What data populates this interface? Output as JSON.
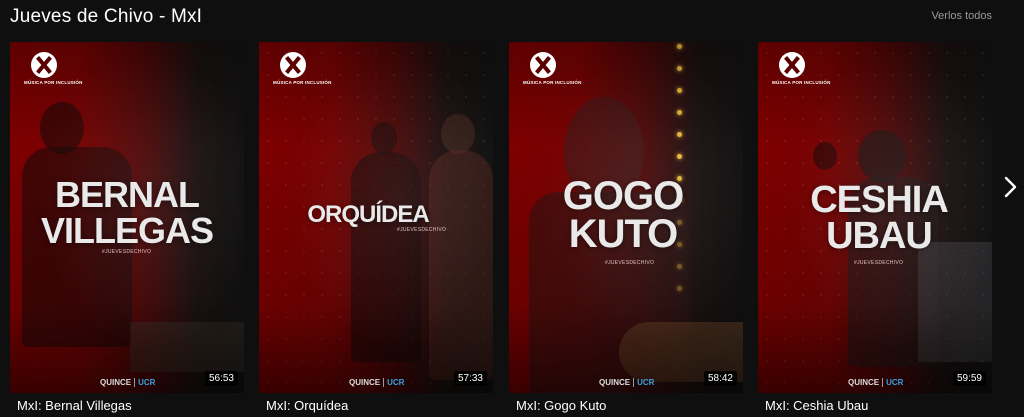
{
  "row": {
    "title": "Jueves de Chivo - MxI",
    "see_all_label": "Verlos todos"
  },
  "cards": [
    {
      "name_lines": [
        "BERNAL",
        "VILLEGAS"
      ],
      "hashtag": "#JUEVESDECHIVO",
      "logo_text": "MÚSICA POR INCLUSIÓN",
      "brand": "QUINCE",
      "brand_sub": "UCR",
      "duration": "56:53",
      "caption": "MxI: Bernal Villegas"
    },
    {
      "name_lines": [
        "ORQUÍDEA"
      ],
      "hashtag": "#JUEVESDECHIVO",
      "logo_text": "MÚSICA POR INCLUSIÓN",
      "brand": "QUINCE",
      "brand_sub": "UCR",
      "duration": "57:33",
      "caption": "MxI: Orquídea"
    },
    {
      "name_lines": [
        "GOGO",
        "KUTO"
      ],
      "hashtag": "#JUEVESDECHIVO",
      "logo_text": "MÚSICA POR INCLUSIÓN",
      "brand": "QUINCE",
      "brand_sub": "UCR",
      "duration": "58:42",
      "caption": "MxI: Gogo Kuto"
    },
    {
      "name_lines": [
        "CESHIA",
        "UBAU"
      ],
      "hashtag": "#JUEVESDECHIVO",
      "logo_text": "MÚSICA POR INCLUSIÓN",
      "brand": "QUINCE",
      "brand_sub": "UCR",
      "duration": "59:59",
      "caption": "MxI: Ceshia Ubau"
    }
  ],
  "icons": {
    "next": "chevron-right-icon"
  },
  "colors": {
    "background": "#0f0f0f",
    "poster_red": "#7e0000",
    "see_all": "#9a9a9a"
  }
}
